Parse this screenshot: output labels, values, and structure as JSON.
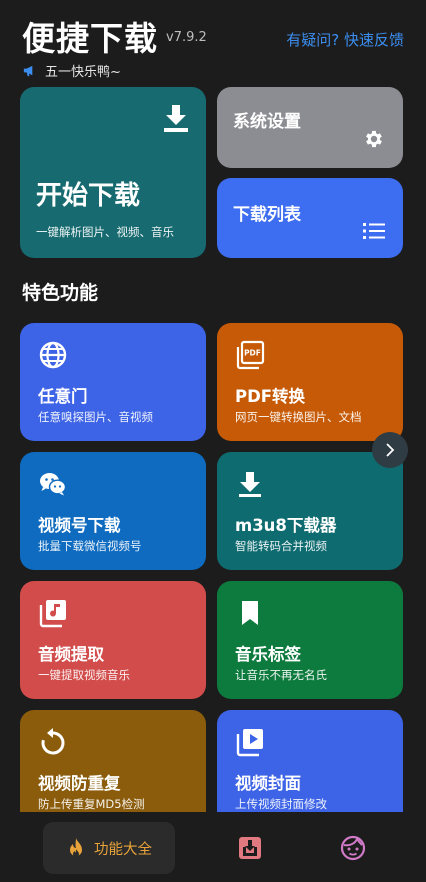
{
  "header": {
    "title": "便捷下载",
    "version": "v7.9.2",
    "feedback_link": "有疑问? 快速反馈",
    "notice": "五一快乐鸭~"
  },
  "main_cards": {
    "start": {
      "title": "开始下载",
      "subtitle": "一键解析图片、视频、音乐",
      "color": "#176b70"
    },
    "settings": {
      "title": "系统设置",
      "color": "#8c8c93"
    },
    "download_list": {
      "title": "下载列表",
      "color": "#3d6df0"
    }
  },
  "section_title": "特色功能",
  "features": [
    {
      "title": "任意门",
      "subtitle": "任意嗅探图片、音视频",
      "color": "#3d63e6",
      "icon": "globe-icon"
    },
    {
      "title": "PDF转换",
      "subtitle": "网页一键转换图片、文档",
      "color": "#c65a06",
      "icon": "pdf-icon"
    },
    {
      "title": "视频号下载",
      "subtitle": "批量下载微信视频号",
      "color": "#0e6bc0",
      "icon": "wechat-icon"
    },
    {
      "title": "m3u8下载器",
      "subtitle": "智能转码合并视频",
      "color": "#0e6b6f",
      "icon": "download-icon"
    },
    {
      "title": "音频提取",
      "subtitle": "一键提取视频音乐",
      "color": "#d14c4a",
      "icon": "music-library-icon"
    },
    {
      "title": "音乐标签",
      "subtitle": "让音乐不再无名氏",
      "color": "#0d7b3e",
      "icon": "bookmark-icon"
    },
    {
      "title": "视频防重复",
      "subtitle": "防上传重复MD5检测",
      "color": "#8a5c0c",
      "icon": "refresh-icon"
    },
    {
      "title": "视频封面",
      "subtitle": "上传视频封面修改",
      "color": "#3d63e6",
      "icon": "video-library-icon"
    }
  ],
  "bottom_nav": {
    "active_label": "功能大全",
    "active_color": "#e8a43a"
  }
}
